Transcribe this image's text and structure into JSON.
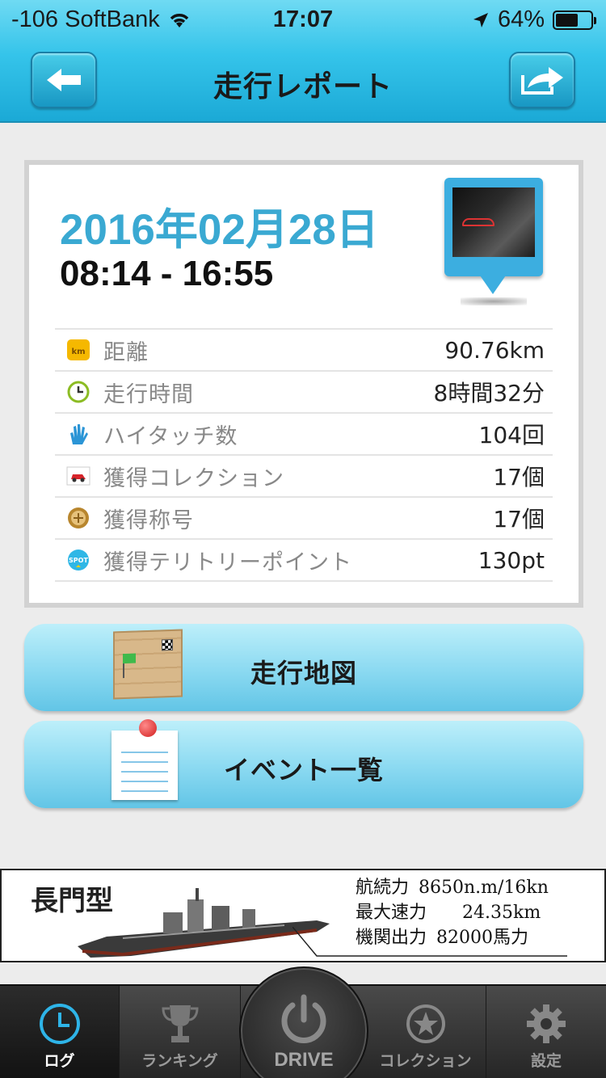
{
  "status_bar": {
    "carrier": "-106 SoftBank",
    "time": "17:07",
    "battery": "64%",
    "battery_level": 0.64
  },
  "header": {
    "title": "走行レポート",
    "back_icon": "arrow-left-icon",
    "share_icon": "share-arrow-icon"
  },
  "report": {
    "date": "2016年02月28日",
    "time_range": "08:14 - 16:55",
    "stats": [
      {
        "icon": "km-icon",
        "label": "距離",
        "value": "90.76km"
      },
      {
        "icon": "clock-icon",
        "label": "走行時間",
        "value": "8時間32分"
      },
      {
        "icon": "hi-five-hand-icon",
        "label": "ハイタッチ数",
        "value": "104回"
      },
      {
        "icon": "car-card-icon",
        "label": "獲得コレクション",
        "value": "17個"
      },
      {
        "icon": "title-medal-icon",
        "label": "獲得称号",
        "value": "17個"
      },
      {
        "icon": "spot-badge-icon",
        "label": "獲得テリトリーポイント",
        "value": "130pt"
      }
    ]
  },
  "actions": {
    "map_label": "走行地図",
    "events_label": "イベント一覧"
  },
  "ad": {
    "name": "長門型",
    "specs": [
      {
        "label": "航続力",
        "value": "8650n.m/16kn"
      },
      {
        "label": "最大速力",
        "value": "24.35km"
      },
      {
        "label": "機関出力",
        "value": "82000馬力"
      }
    ]
  },
  "tabs": {
    "log": "ログ",
    "ranking": "ランキング",
    "drive": "DRIVE",
    "collection": "コレクション",
    "settings": "設定"
  },
  "colors": {
    "accent": "#3aa9d2",
    "header": "#35c4ea",
    "button": "#8ad9f1"
  }
}
